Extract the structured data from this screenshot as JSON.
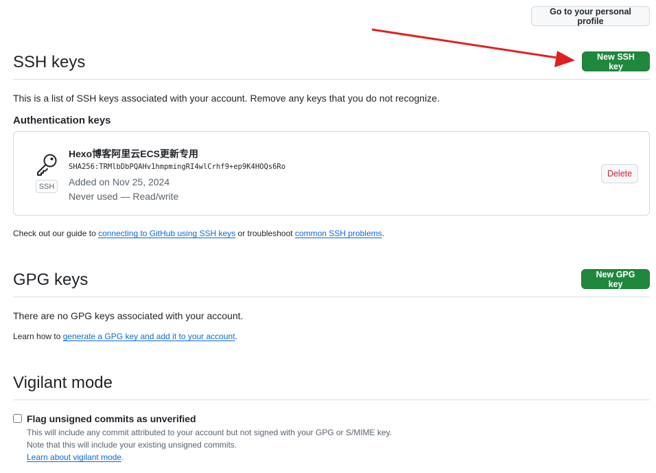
{
  "header": {
    "profile_button": "Go to your personal profile"
  },
  "ssh": {
    "title": "SSH keys",
    "new_button": "New SSH key",
    "description": "This is a list of SSH keys associated with your account. Remove any keys that you do not recognize.",
    "auth_heading": "Authentication keys",
    "key": {
      "badge": "SSH",
      "title": "Hexo博客阿里云ECS更新专用",
      "fingerprint": "SHA256:TRMlbDbPQAHv1hmpmingRI4wlCrhf9+ep9K4HOQs6Ro",
      "added": "Added on Nov 25, 2024",
      "usage": "Never used — Read/write",
      "delete_button": "Delete"
    },
    "guide": {
      "prefix": "Check out our guide to ",
      "link1": "connecting to GitHub using SSH keys",
      "middle": " or troubleshoot ",
      "link2": "common SSH problems",
      "suffix": "."
    }
  },
  "gpg": {
    "title": "GPG keys",
    "new_button": "New GPG key",
    "empty_text": "There are no GPG keys associated with your account.",
    "learn": {
      "prefix": "Learn how to ",
      "link": "generate a GPG key and add it to your account",
      "suffix": "."
    }
  },
  "vigilant": {
    "title": "Vigilant mode",
    "checkbox_label": "Flag unsigned commits as unverified",
    "note1": "This will include any commit attributed to your account but not signed with your GPG or S/MIME key.",
    "note2": "Note that this will include your existing unsigned commits.",
    "learn_link": "Learn about vigilant mode",
    "learn_suffix": "."
  },
  "colors": {
    "primary_green": "#1f883d",
    "danger_red": "#cf222e",
    "link_blue": "#0969da",
    "annotation_arrow": "#e02020"
  },
  "icons": {
    "key": "key-icon",
    "arrow": "red-annotation-arrow"
  }
}
